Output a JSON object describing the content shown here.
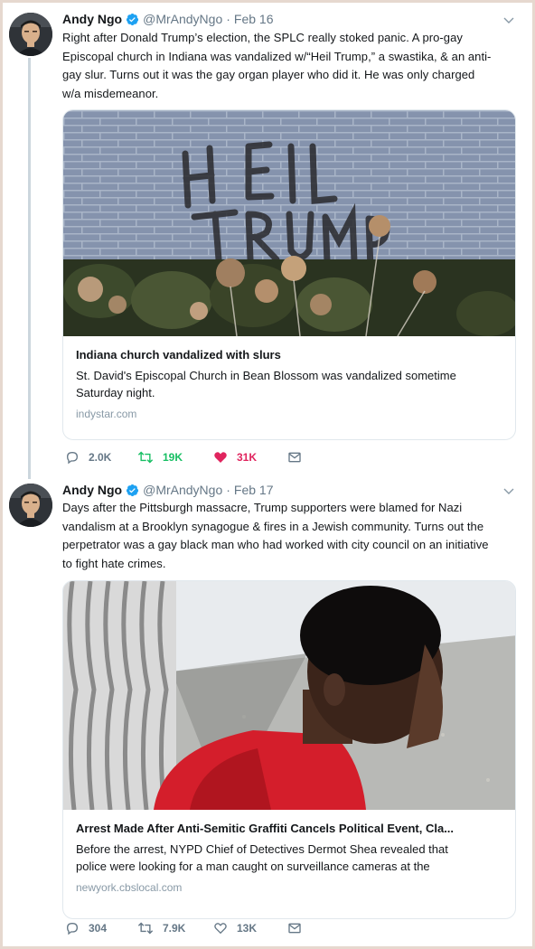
{
  "colors": {
    "text": "#14171a",
    "muted": "#657786",
    "verified": "#1da1f2",
    "retweeted": "#17bf63",
    "liked": "#e0245e",
    "frame": "#e6d8cf"
  },
  "tweets": [
    {
      "author": {
        "name": "Andy Ngo",
        "handle": "@MrAndyNgo",
        "verified_icon": "verified-badge-icon",
        "avatar": "avatar"
      },
      "date": "Feb 16",
      "caret_icon": "chevron-down-icon",
      "text_lines": [
        "Right after Donald Trump’s election, the SPLC really stoked panic. A pro-gay",
        "Episcopal church in Indiana was vandalized w/“Heil Trump,” a swastika, & an anti-",
        "gay slur. Turns out it was the gay organ player who did it. He was only charged",
        "w/a misdemeanor."
      ],
      "card": {
        "image_text": [
          "HEIL",
          "TRUMP"
        ],
        "title": "Indiana church vandalized with slurs",
        "description_lines": [
          "St. David's Episcopal Church in Bean Blossom was vandalized sometime",
          "Saturday night."
        ],
        "domain": "indystar.com"
      },
      "actions": {
        "replies": "2.0K",
        "retweets": "19K",
        "likes": "31K",
        "retweeted": true,
        "liked": true
      }
    },
    {
      "author": {
        "name": "Andy Ngo",
        "handle": "@MrAndyNgo",
        "verified_icon": "verified-badge-icon",
        "avatar": "avatar"
      },
      "date": "Feb 17",
      "caret_icon": "chevron-down-icon",
      "text_lines": [
        "Days after the Pittsburgh massacre, Trump supporters were blamed for Nazi",
        "vandalism at a Brooklyn synagogue & fires in a Jewish community. Turns out the",
        "perpetrator was a gay black man who had worked with city council on an initiative",
        "to fight hate crimes."
      ],
      "card": {
        "title": "Arrest Made After Anti-Semitic Graffiti Cancels Political Event, Cla...",
        "description_lines": [
          "Before the arrest, NYPD Chief of Detectives Dermot Shea revealed that",
          "police were looking for a man caught on surveillance cameras at the"
        ],
        "domain": "newyork.cbslocal.com"
      },
      "actions": {
        "replies": "304",
        "retweets": "7.9K",
        "likes": "13K",
        "retweeted": false,
        "liked": false
      }
    }
  ]
}
